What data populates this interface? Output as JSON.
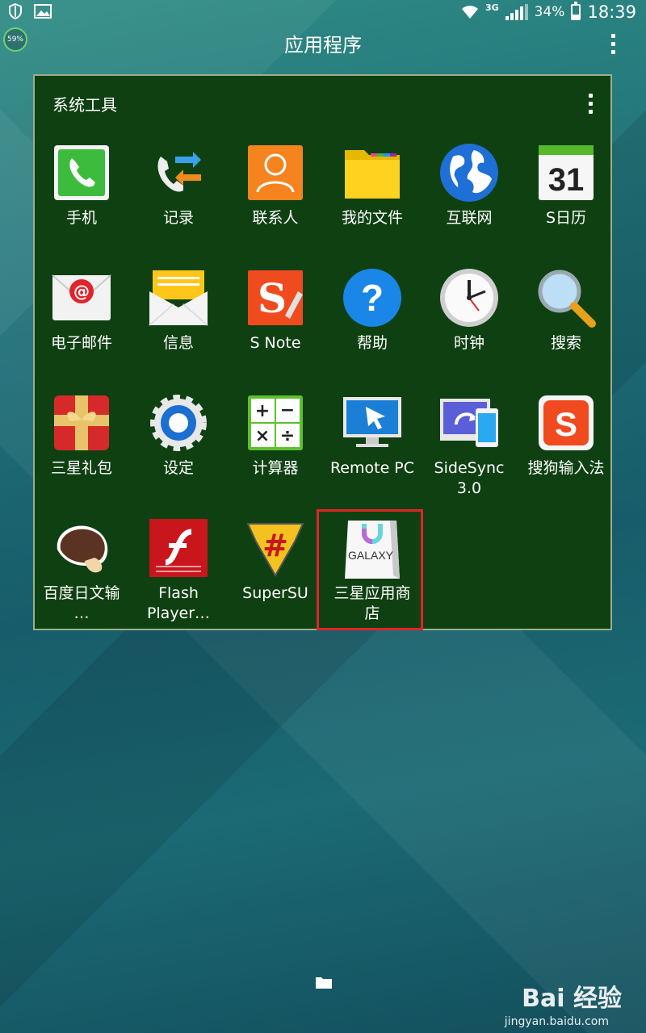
{
  "status_bar": {
    "network": "3G",
    "battery_percent": "34%",
    "time": "18:39",
    "badge_percent": "59%"
  },
  "title_bar": {
    "title": "应用程序"
  },
  "folder": {
    "title": "系统工具",
    "apps": [
      {
        "label": "手机",
        "icon": "phone-icon"
      },
      {
        "label": "记录",
        "icon": "call-log-icon"
      },
      {
        "label": "联系人",
        "icon": "contacts-icon"
      },
      {
        "label": "我的文件",
        "icon": "folder-icon"
      },
      {
        "label": "互联网",
        "icon": "globe-icon"
      },
      {
        "label": "S日历",
        "icon": "calendar-icon",
        "day": "31"
      },
      {
        "label": "电子邮件",
        "icon": "email-icon"
      },
      {
        "label": "信息",
        "icon": "message-icon"
      },
      {
        "label": "S Note",
        "icon": "snote-icon"
      },
      {
        "label": "帮助",
        "icon": "help-icon"
      },
      {
        "label": "时钟",
        "icon": "clock-icon"
      },
      {
        "label": "搜索",
        "icon": "search-icon"
      },
      {
        "label": "三星礼包",
        "icon": "gift-icon"
      },
      {
        "label": "设定",
        "icon": "gear-icon"
      },
      {
        "label": "计算器",
        "icon": "calculator-icon"
      },
      {
        "label": "Remote PC",
        "icon": "remote-pc-icon"
      },
      {
        "label": "SideSync 3.0",
        "icon": "sidesync-icon"
      },
      {
        "label": "搜狗输入法",
        "icon": "sogou-icon"
      },
      {
        "label": "百度日文输 …",
        "icon": "mushroom-icon"
      },
      {
        "label": "Flash Player…",
        "icon": "flash-icon"
      },
      {
        "label": "SuperSU",
        "icon": "supersu-icon"
      },
      {
        "label": "三星应用商 店",
        "icon": "galaxy-apps-icon",
        "highlighted": true,
        "icon_text": "GALAXY"
      }
    ]
  },
  "watermark": {
    "brand": "Bai 经验",
    "url": "jingyan.baidu.com"
  },
  "colors": {
    "folder_bg": "#0f4012",
    "highlight": "#e0242c"
  }
}
